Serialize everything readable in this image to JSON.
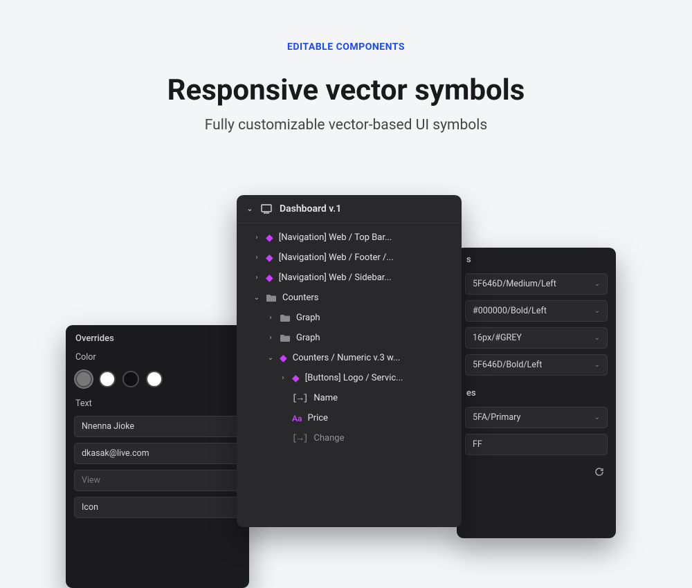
{
  "header": {
    "eyebrow": "EDITABLE COMPONENTS",
    "headline": "Responsive vector symbols",
    "subhead": "Fully customizable vector-based UI symbols"
  },
  "center": {
    "title": "Dashboard v.1",
    "rows": [
      {
        "label": "[Navigation] Web / Top Bar..."
      },
      {
        "label": "[Navigation] Web / Footer /..."
      },
      {
        "label": "[Navigation] Web / Sidebar..."
      },
      {
        "label": "Counters"
      },
      {
        "label": "Graph"
      },
      {
        "label": "Graph"
      },
      {
        "label": "Counters / Numeric v.3 w..."
      },
      {
        "label": "[Buttons] Logo / Servic..."
      },
      {
        "label": "Name"
      },
      {
        "label": "Price"
      },
      {
        "label": "Change"
      }
    ]
  },
  "left": {
    "title": "Overrides",
    "color_label": "Color",
    "swatches": [
      "#777777",
      "#ffffff",
      "#111111",
      "#ffffff"
    ],
    "text_label": "Text",
    "text_inputs": [
      "Nnenna Jioke",
      "dkasak@live.com",
      "View",
      "Icon"
    ]
  },
  "right": {
    "sections": [
      {
        "head": "s",
        "items": [
          "5F646D/Medium/Left",
          "#000000/Bold/Left",
          "16px/#GREY",
          "5F646D/Bold/Left"
        ]
      },
      {
        "head": "es",
        "items": [
          "5FA/Primary",
          "FF"
        ]
      }
    ]
  }
}
